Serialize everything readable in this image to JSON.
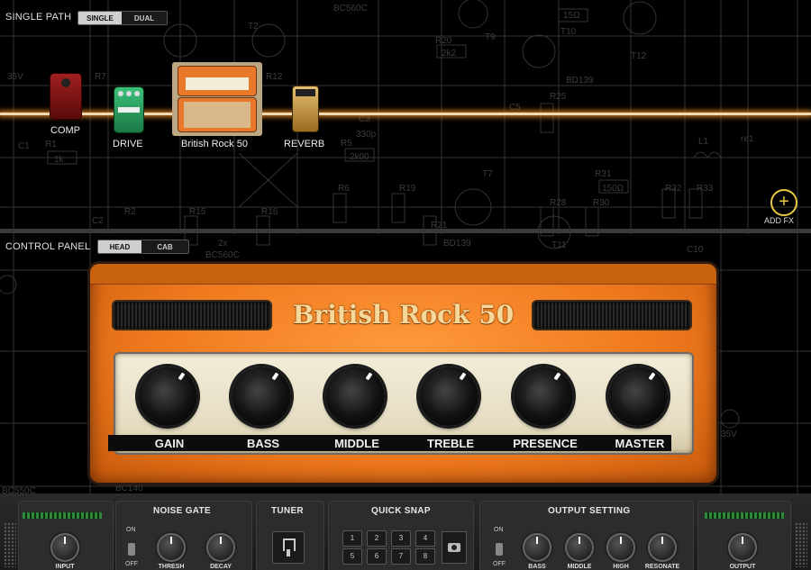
{
  "signal_path": {
    "title": "SINGLE PATH",
    "modes": [
      "SINGLE",
      "DUAL"
    ],
    "active_mode": "SINGLE"
  },
  "chain": [
    {
      "name": "COMP",
      "kind": "pedal",
      "color": "#8a1a1a"
    },
    {
      "name": "DRIVE",
      "kind": "pedal",
      "color": "#2a9a5a"
    },
    {
      "name": "British Rock 50",
      "kind": "amp",
      "color": "#e8792a"
    },
    {
      "name": "REVERB",
      "kind": "pedal",
      "color": "#c89a40"
    }
  ],
  "add_fx": {
    "label": "ADD FX"
  },
  "control_panel": {
    "title": "CONTROL PANEL",
    "tabs": [
      "HEAD",
      "CAB"
    ],
    "active_tab": "HEAD"
  },
  "amp": {
    "name": "British Rock 50",
    "knobs": [
      "GAIN",
      "BASS",
      "MIDDLE",
      "TREBLE",
      "PRESENCE",
      "MASTER"
    ]
  },
  "schematic_text": {
    "labels": [
      "BC560C",
      "35V",
      "R7",
      "R12",
      "T2",
      "R20",
      "2k2",
      "T9",
      "15Ω",
      "T10",
      "BD139",
      "T12",
      "R25",
      "C1",
      "R1",
      "1k",
      "C5",
      "330p",
      "R5",
      "2k00",
      "C3",
      "T7",
      "R31",
      "150Ω",
      "R32",
      "R33",
      "L1",
      "re1",
      "R6",
      "R19",
      "R21",
      "R28",
      "R30",
      "C2",
      "R2",
      "R15",
      "R16",
      "2x",
      "BC560C",
      "BD139",
      "T11",
      "C10",
      "35V",
      "BC550C",
      "BC140"
    ]
  },
  "bottom_bar": {
    "input_label": "INPUT",
    "noise_gate": {
      "title": "NOISE GATE",
      "on": "ON",
      "off": "OFF",
      "knobs": [
        "THRESH",
        "DECAY"
      ]
    },
    "tuner": {
      "title": "TUNER"
    },
    "quick_snap": {
      "title": "QUICK SNAP",
      "slots": [
        "1",
        "2",
        "3",
        "4",
        "5",
        "6",
        "7",
        "8"
      ]
    },
    "output_setting": {
      "title": "OUTPUT SETTING",
      "on": "ON",
      "off": "OFF",
      "knobs": [
        "BASS",
        "MIDDLE",
        "HIGH",
        "RESONATE"
      ]
    },
    "output_label": "OUTPUT"
  },
  "colors": {
    "amp_tolex": "#f07a1e",
    "chain_glow": "#d07a20",
    "add_fx_accent": "#e8c840",
    "title_gold": "#f6d89a"
  }
}
